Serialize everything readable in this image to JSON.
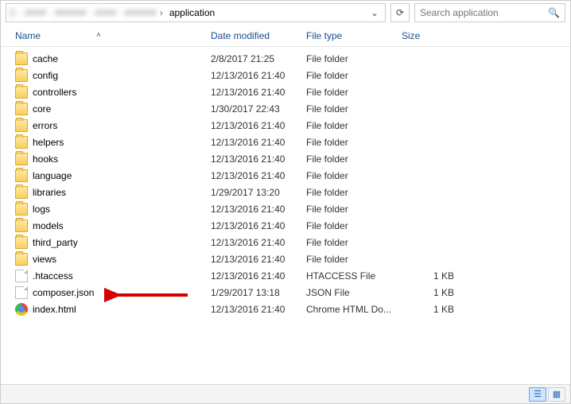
{
  "breadcrumb": {
    "hidden_prefix": "C  ·  ####  ·  ######  ·  ####  ·  ######",
    "current": "application"
  },
  "search": {
    "placeholder": "Search application"
  },
  "columns": {
    "name": "Name",
    "date": "Date modified",
    "type": "File type",
    "size": "Size"
  },
  "types": {
    "folder": "File folder",
    "htaccess": "HTACCESS File",
    "json": "JSON File",
    "chrome": "Chrome HTML Do..."
  },
  "items": [
    {
      "name": "cache",
      "date": "2/8/2017 21:25",
      "typeKey": "folder",
      "icon": "folder",
      "size": ""
    },
    {
      "name": "config",
      "date": "12/13/2016 21:40",
      "typeKey": "folder",
      "icon": "folder",
      "size": ""
    },
    {
      "name": "controllers",
      "date": "12/13/2016 21:40",
      "typeKey": "folder",
      "icon": "folder",
      "size": ""
    },
    {
      "name": "core",
      "date": "1/30/2017 22:43",
      "typeKey": "folder",
      "icon": "folder",
      "size": ""
    },
    {
      "name": "errors",
      "date": "12/13/2016 21:40",
      "typeKey": "folder",
      "icon": "folder",
      "size": ""
    },
    {
      "name": "helpers",
      "date": "12/13/2016 21:40",
      "typeKey": "folder",
      "icon": "folder",
      "size": ""
    },
    {
      "name": "hooks",
      "date": "12/13/2016 21:40",
      "typeKey": "folder",
      "icon": "folder",
      "size": ""
    },
    {
      "name": "language",
      "date": "12/13/2016 21:40",
      "typeKey": "folder",
      "icon": "folder",
      "size": ""
    },
    {
      "name": "libraries",
      "date": "1/29/2017 13:20",
      "typeKey": "folder",
      "icon": "folder",
      "size": ""
    },
    {
      "name": "logs",
      "date": "12/13/2016 21:40",
      "typeKey": "folder",
      "icon": "folder",
      "size": ""
    },
    {
      "name": "models",
      "date": "12/13/2016 21:40",
      "typeKey": "folder",
      "icon": "folder",
      "size": ""
    },
    {
      "name": "third_party",
      "date": "12/13/2016 21:40",
      "typeKey": "folder",
      "icon": "folder",
      "size": ""
    },
    {
      "name": "views",
      "date": "12/13/2016 21:40",
      "typeKey": "folder",
      "icon": "folder",
      "size": ""
    },
    {
      "name": ".htaccess",
      "date": "12/13/2016 21:40",
      "typeKey": "htaccess",
      "icon": "file",
      "size": "1 KB"
    },
    {
      "name": "composer.json",
      "date": "1/29/2017 13:18",
      "typeKey": "json",
      "icon": "file",
      "size": "1 KB"
    },
    {
      "name": "index.html",
      "date": "12/13/2016 21:40",
      "typeKey": "chrome",
      "icon": "chrome",
      "size": "1 KB"
    }
  ]
}
